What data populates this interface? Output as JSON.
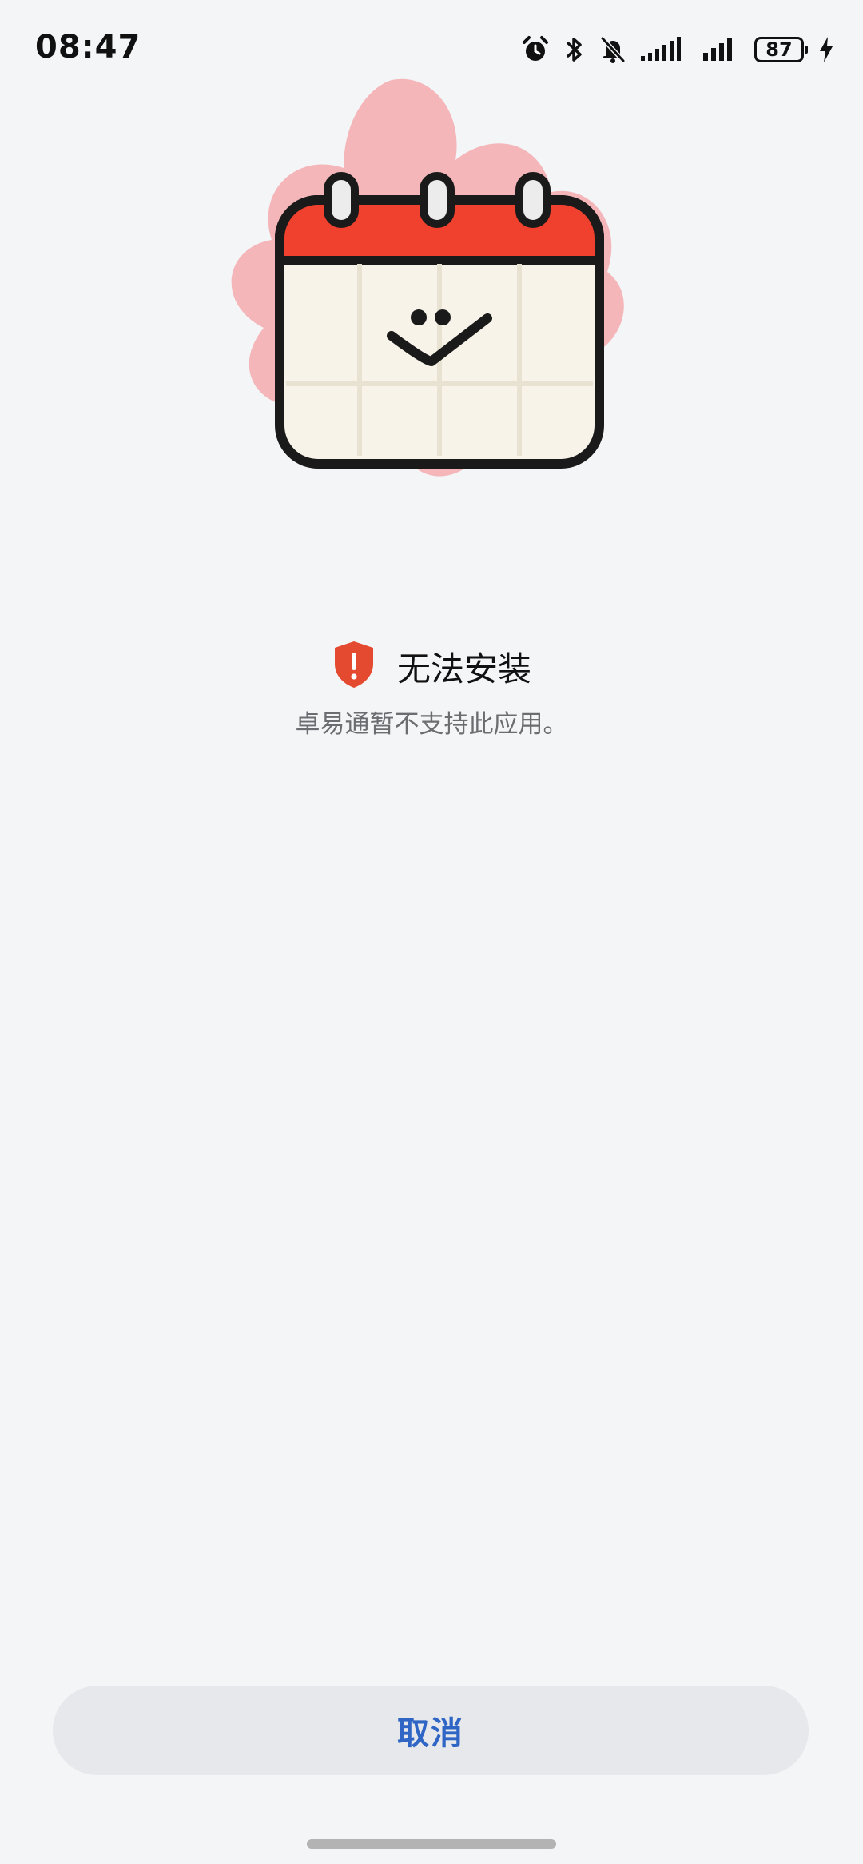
{
  "status_bar": {
    "time": "08:47",
    "battery_level": "87",
    "icons": [
      "alarm-icon",
      "bluetooth-icon",
      "bell-muted-icon",
      "signal-icon",
      "signal-icon",
      "battery-icon",
      "charging-icon"
    ]
  },
  "illustration": {
    "name": "calendar-smiley-illustration",
    "colors": {
      "header": "#f0402e",
      "body": "#f7f3e8",
      "outline": "#1a1a1a",
      "splash": "#f5a0a5"
    }
  },
  "error": {
    "icon": "shield-alert-icon",
    "icon_color": "#e44a2f",
    "title": "无法安装",
    "message": "卓易通暂不支持此应用。"
  },
  "actions": {
    "cancel_label": "取消",
    "cancel_color": "#2f66c6"
  }
}
